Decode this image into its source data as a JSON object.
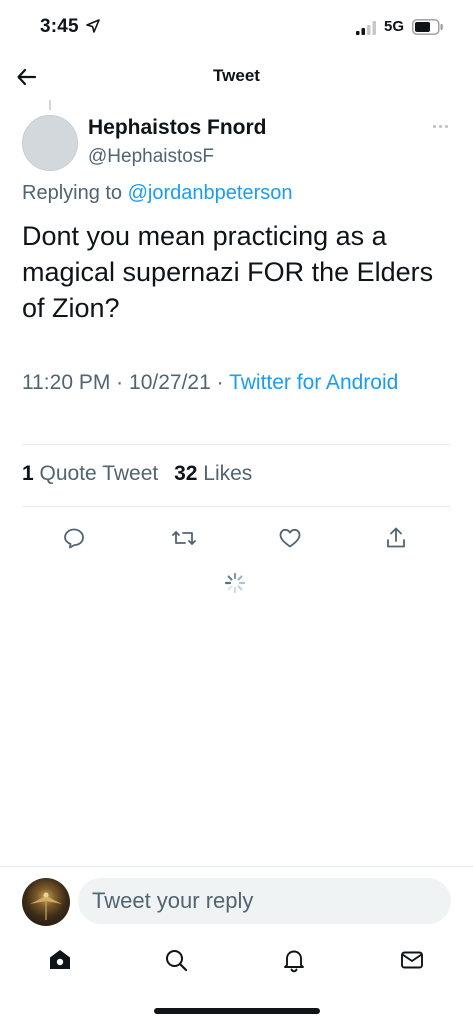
{
  "status_bar": {
    "time": "3:45",
    "network": "5G"
  },
  "header": {
    "title": "Tweet"
  },
  "tweet": {
    "author_name": "Hephaistos Fnord",
    "author_handle": "@HephaistosF",
    "replying_prefix": "Replying to",
    "replying_to": "@jordanbpeterson",
    "text": "Dont you mean practicing as a magical supernazi FOR the Elders of Zion?",
    "time": "11:20 PM",
    "date": "10/27/21",
    "source": "Twitter for Android"
  },
  "stats": {
    "quote_count": "1",
    "quote_label": "Quote Tweet",
    "like_count": "32",
    "like_label": "Likes"
  },
  "reply": {
    "placeholder": "Tweet your reply"
  },
  "icons": {
    "back": "arrow-left-icon",
    "more": "more-icon",
    "reply": "comment-icon",
    "retweet": "retweet-icon",
    "like": "heart-icon",
    "share": "share-icon",
    "home": "home-icon",
    "search": "search-icon",
    "notifications": "bell-icon",
    "messages": "mail-icon"
  },
  "colors": {
    "accent": "#1d9bf0",
    "text": "#0f1419",
    "secondary": "#536471"
  }
}
